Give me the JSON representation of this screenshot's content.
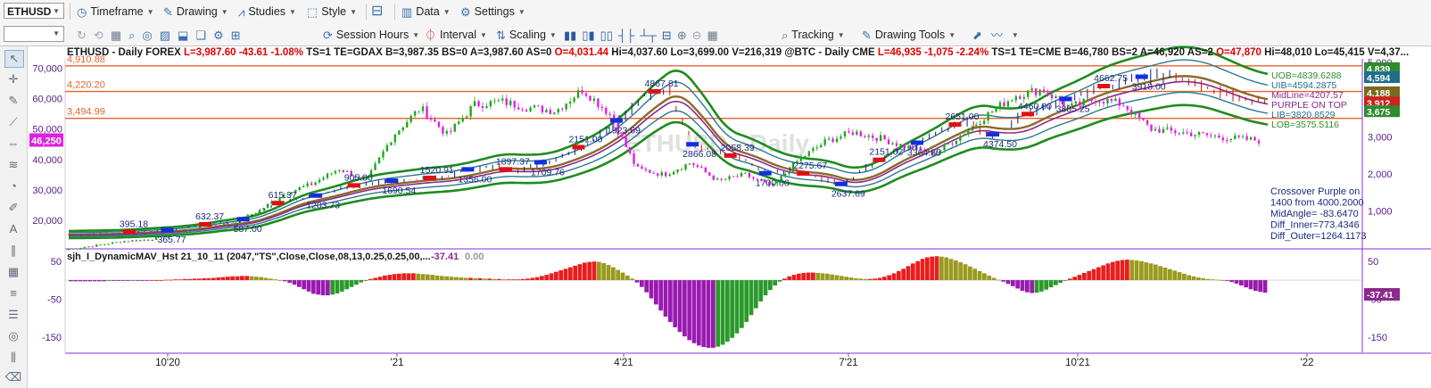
{
  "toolbar1": {
    "symbol": "ETHUSD",
    "items": [
      "Timeframe",
      "Drawing",
      "Studies",
      "Style",
      "Data",
      "Settings"
    ]
  },
  "toolbar2": {
    "items": [
      "Session Hours",
      "Interval",
      "Scaling",
      "Tracking",
      "Drawing Tools"
    ]
  },
  "header_segments": [
    {
      "text": "ETHUSD - Daily  FOREX ",
      "color": "#1a1a1a"
    },
    {
      "text": "L=3,987.60 -43.61 -1.08%",
      "color": "#e00000"
    },
    {
      "text": " TS=1  TE=GDAX  B=3,987.35  BS=0  A=3,987.60  AS=0 ",
      "color": "#1a1a1a"
    },
    {
      "text": "O=4,031.44",
      "color": "#e00000"
    },
    {
      "text": " Hi=4,037.60  Lo=3,699.00  V=216,319  @BTC - Daily  CME ",
      "color": "#1a1a1a"
    },
    {
      "text": "L=46,935 -1,075 -2.24%",
      "color": "#e00000"
    },
    {
      "text": "  TS=1  TE=CME  B=46,780  BS=2  A=46,920  AS=2 ",
      "color": "#1a1a1a"
    },
    {
      "text": "O=47,870",
      "color": "#e00000"
    },
    {
      "text": "  Hi=48,010  Lo=45,415  V=4,37...",
      "color": "#1a1a1a"
    }
  ],
  "watermark": "ETHUSD - Daily",
  "chart_data": [
    {
      "type": "candlestick",
      "title": "ETHUSD - Daily  FOREX / @BTC - Daily  CME",
      "left_axis": {
        "label": "@BTC",
        "ticks": [
          "20,000",
          "30,000",
          "40,000",
          "50,000",
          "60,000",
          "70,000"
        ],
        "range": [
          11000,
          73000
        ],
        "marker": "46,250"
      },
      "right_axis": {
        "label": "ETHUSD",
        "ticks": [
          "1,000",
          "2,000",
          "3,000",
          "4,000",
          "5,000"
        ],
        "range": [
          0,
          5100
        ],
        "markers": [
          {
            "value": "4,839",
            "color": "#2e8b2e"
          },
          {
            "value": "4,594",
            "color": "#1f6e8a"
          },
          {
            "value": "4,188",
            "color": "#7a6a1e"
          },
          {
            "value": "3,912",
            "color": "#d02020"
          },
          {
            "value": "3,675",
            "color": "#2e8b2e"
          }
        ]
      },
      "x_ticks": [
        "10'20",
        "'21",
        "4'21",
        "7'21",
        "10'21",
        "'22"
      ],
      "horizontal_levels": [
        {
          "label": "4,910.88",
          "value": 4910.88
        },
        {
          "label": "4,220.20",
          "value": 4220.2
        },
        {
          "label": "3,494.99",
          "value": 3494.99
        }
      ],
      "btc_close": [
        10600,
        11800,
        13200,
        13800,
        15500,
        18500,
        19000,
        23000,
        29000,
        32000,
        37000,
        33000,
        48000,
        57000,
        48000,
        58000,
        59000,
        57000,
        56000,
        63000,
        55000,
        37000,
        35000,
        39000,
        33000,
        35000,
        31000,
        40000,
        46000,
        49000,
        47000,
        44000,
        42000,
        48000,
        55000,
        61000,
        63000,
        57000,
        60000,
        58000,
        50000,
        49000,
        48000,
        47000,
        46250
      ],
      "eth_close": [
        360,
        380,
        400,
        450,
        470,
        580,
        660,
        730,
        1100,
        1300,
        1400,
        1650,
        1700,
        1800,
        1850,
        1900,
        2100,
        2200,
        2050,
        2300,
        2500,
        2900,
        3400,
        4100,
        4300,
        2800,
        2600,
        2400,
        2000,
        2100,
        1900,
        1700,
        2200,
        2500,
        2800,
        3200,
        3400,
        3000,
        3500,
        3700,
        4000,
        4300,
        4400,
        4600,
        4700,
        4500,
        4200,
        4000,
        3912
      ],
      "band_labels": [
        {
          "text": "UOB=4839.6288",
          "color": "#2e8b2e"
        },
        {
          "text": "UIB=4594.2875",
          "color": "#1f6e8a"
        },
        {
          "text": "MidLine=4207.57",
          "color": "#8b2a8b"
        },
        {
          "text": "PURPLE ON TOP",
          "color": "#8b2a8b"
        },
        {
          "text": "LIB=3820.8529",
          "color": "#1f6e8a"
        },
        {
          "text": "LOB=3575.5116",
          "color": "#2e8b2e"
        }
      ],
      "swing_labels": [
        "395.18",
        "365.77",
        "632.37",
        "587.00",
        "615.37",
        "1203.73",
        "905.00",
        "1690.54",
        "1520.91",
        "1356.00",
        "1897.37",
        "1709.76",
        "2151.00",
        "1923.69",
        "4867.81",
        "2866.08",
        "2058.39",
        "1700.00",
        "2275.67",
        "2637.69",
        "2151.02",
        "3364.85",
        "2651.00",
        "4374.50",
        "4460.00",
        "3885.25",
        "4662.75",
        "3918.00"
      ],
      "info_box": [
        "Crossover Purple on",
        "1400 from 4000.2000",
        "MidAngle= -83.6470",
        "Diff_Inner=773.4346",
        "Diff_Outer=1264.1173"
      ]
    },
    {
      "type": "bar",
      "title": "sjh_I_DynamicMAV_Hst 21_10_11 (2047,\"TS\",Close,Close,08,13,0.25,0.25,00,...",
      "values_label": "-37.41",
      "values_label2": "0.00",
      "ticks": [
        "50",
        "-50",
        "-150"
      ],
      "marker": "-37.41",
      "range": [
        -190,
        80
      ],
      "values": [
        -3,
        -3,
        -3,
        -3,
        -3,
        -3,
        -3,
        -3,
        -2,
        -2,
        -2,
        -2,
        -2,
        -1,
        -1,
        -1,
        -1,
        0,
        0,
        0,
        1,
        1,
        2,
        2,
        3,
        3,
        4,
        4,
        5,
        5,
        6,
        7,
        8,
        9,
        10,
        10,
        11,
        11,
        10,
        9,
        8,
        6,
        4,
        2,
        0,
        -3,
        -7,
        -12,
        -18,
        -24,
        -30,
        -36,
        -38,
        -40,
        -40,
        -38,
        -35,
        -30,
        -24,
        -18,
        -12,
        -6,
        -1,
        3,
        6,
        9,
        12,
        14,
        16,
        17,
        18,
        18,
        18,
        17,
        16,
        15,
        14,
        12,
        11,
        10,
        9,
        8,
        7,
        6,
        6,
        5,
        5,
        4,
        4,
        3,
        3,
        2,
        2,
        2,
        2,
        3,
        4,
        6,
        8,
        11,
        14,
        18,
        22,
        26,
        30,
        34,
        38,
        42,
        46,
        48,
        49,
        48,
        45,
        40,
        34,
        27,
        20,
        12,
        4,
        -6,
        -18,
        -32,
        -48,
        -64,
        -80,
        -96,
        -110,
        -124,
        -136,
        -148,
        -158,
        -166,
        -172,
        -176,
        -178,
        -178,
        -175,
        -170,
        -162,
        -152,
        -140,
        -126,
        -110,
        -92,
        -74,
        -56,
        -40,
        -26,
        -14,
        -4,
        4,
        10,
        14,
        17,
        19,
        20,
        20,
        19,
        18,
        17,
        15,
        13,
        11,
        9,
        7,
        5,
        4,
        3,
        3,
        4,
        6,
        9,
        13,
        18,
        24,
        30,
        37,
        44,
        50,
        56,
        60,
        62,
        63,
        62,
        60,
        56,
        52,
        47,
        42,
        36,
        30,
        24,
        18,
        12,
        6,
        1,
        -4,
        -10,
        -16,
        -22,
        -28,
        -32,
        -34,
        -33,
        -30,
        -25,
        -19,
        -13,
        -7,
        -1,
        4,
        9,
        14,
        19,
        24,
        29,
        34,
        39,
        44,
        48,
        51,
        53,
        54,
        53,
        52,
        50,
        47,
        44,
        41,
        37,
        33,
        29,
        25,
        21,
        17,
        13,
        10,
        7,
        5,
        3,
        2,
        1,
        0,
        -2,
        -5,
        -9,
        -14,
        -19,
        -24,
        -28,
        -31,
        -33
      ]
    }
  ]
}
